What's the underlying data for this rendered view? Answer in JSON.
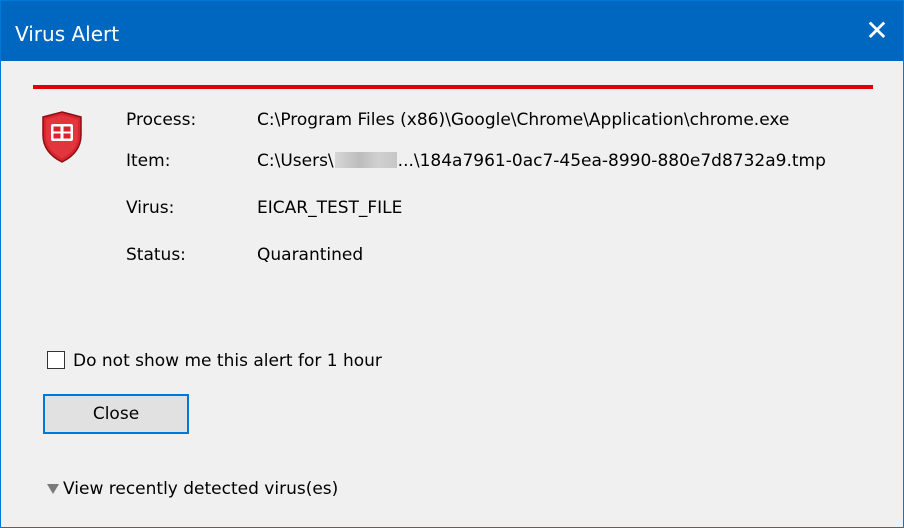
{
  "window": {
    "title": "Virus Alert",
    "close_glyph": "✕"
  },
  "colors": {
    "titlebar": "#0067c0",
    "alert_line": "#e00000",
    "shield_red": "#d9232d",
    "button_border": "#0078d7"
  },
  "icon": {
    "name": "shield-icon"
  },
  "details": {
    "process_label": "Process:",
    "process_value": "C:\\Program Files (x86)\\Google\\Chrome\\Application\\chrome.exe",
    "item_label": "Item:",
    "item_value_prefix": "C:\\Users\\",
    "item_value_suffix": "...\\184a7961-0ac7-45ea-8990-880e7d8732a9.tmp",
    "virus_label": "Virus:",
    "virus_value": "EICAR_TEST_FILE",
    "status_label": "Status:",
    "status_value": "Quarantined"
  },
  "options": {
    "suppress_label": "Do not show me this alert for 1 hour",
    "suppress_checked": false
  },
  "buttons": {
    "close_label": "Close"
  },
  "expander": {
    "label": "View recently detected virus(es)"
  }
}
